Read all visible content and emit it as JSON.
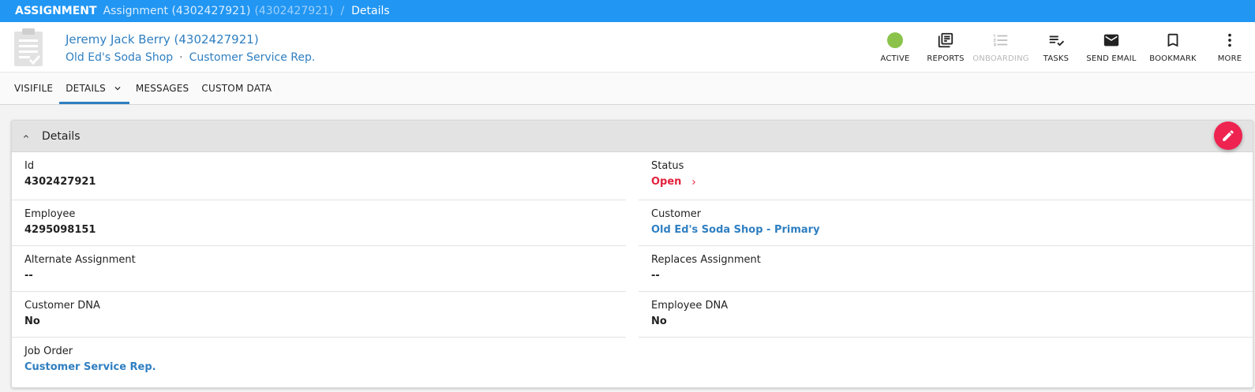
{
  "breadcrumb": {
    "section": "ASSIGNMENT",
    "item": "Assignment (4302427921)",
    "item_id": "(4302427921)",
    "separator": "/",
    "current": "Details"
  },
  "header": {
    "title": "Jeremy Jack Berry (4302427921)",
    "customer": "Old Ed's Soda Shop",
    "dot": "·",
    "job": "Customer Service Rep."
  },
  "actions": {
    "active": "ACTIVE",
    "reports": "REPORTS",
    "onboarding": "ONBOARDING",
    "tasks": "TASKS",
    "send_email": "SEND EMAIL",
    "bookmark": "BOOKMARK",
    "more": "MORE"
  },
  "colors": {
    "topbar": "#2196f3",
    "link": "#2f7fc1",
    "active_status": "#8bc34a",
    "status_open": "#e3213c",
    "fab": "#ee2350"
  },
  "tabs": {
    "visifile": "VISIFILE",
    "details": "DETAILS",
    "messages": "MESSAGES",
    "custom_data": "CUSTOM DATA"
  },
  "details": {
    "title": "Details",
    "left": [
      {
        "label": "Id",
        "value": "4302427921"
      },
      {
        "label": "Employee",
        "value": "4295098151"
      },
      {
        "label": "Alternate Assignment",
        "value": "--"
      },
      {
        "label": "Customer DNA",
        "value": "No"
      },
      {
        "label": "Job Order",
        "value": "Customer Service Rep."
      }
    ],
    "right": [
      {
        "label": "Status",
        "value": "Open"
      },
      {
        "label": "Customer",
        "value": "Old Ed's Soda Shop - Primary"
      },
      {
        "label": "Replaces Assignment",
        "value": "--"
      },
      {
        "label": "Employee DNA",
        "value": "No"
      }
    ]
  }
}
